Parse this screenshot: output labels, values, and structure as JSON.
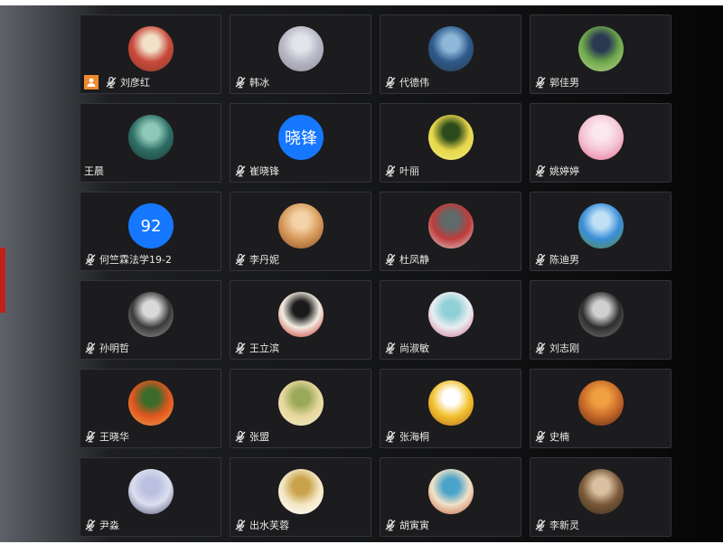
{
  "colors": {
    "tile_bg": "#1c1c1e",
    "text_avatar_bg": "#1677ff",
    "host_badge": "#f08a2c",
    "mic_muted": "#e8e8e8"
  },
  "participants": [
    {
      "name": "刘彦红",
      "muted": true,
      "host": true,
      "avatar": {
        "icon": "portrait-photo",
        "colors": [
          "#c94a3c",
          "#f2e1c9",
          "#8e3b2e"
        ]
      }
    },
    {
      "name": "韩冰",
      "muted": true,
      "avatar": {
        "icon": "portrait-photo",
        "colors": [
          "#b7b7c5",
          "#e3e3ea",
          "#8c8c9c"
        ]
      }
    },
    {
      "name": "代德伟",
      "muted": true,
      "avatar": {
        "icon": "landscape-photo",
        "colors": [
          "#2d5a8a",
          "#8fb8d8",
          "#2a3c4a"
        ]
      }
    },
    {
      "name": "郭佳男",
      "muted": true,
      "avatar": {
        "icon": "portrait-photo",
        "colors": [
          "#6ea84b",
          "#2a3852",
          "#b8d58f"
        ]
      }
    },
    {
      "name": "王晨",
      "muted": false,
      "avatar": {
        "icon": "illustration",
        "colors": [
          "#2f6e66",
          "#8ec9b8",
          "#1d3a35"
        ]
      }
    },
    {
      "name": "崔晓锋",
      "muted": true,
      "avatar": {
        "text": "晓锋",
        "colors": [
          "#1677ff"
        ]
      }
    },
    {
      "name": "叶丽",
      "muted": true,
      "avatar": {
        "icon": "flower-photo",
        "colors": [
          "#e6d64a",
          "#2d4a1a",
          "#f0f080"
        ]
      }
    },
    {
      "name": "姚婷婷",
      "muted": true,
      "avatar": {
        "icon": "anime-illustration",
        "colors": [
          "#f4c5d3",
          "#fbe7ee",
          "#e36a95"
        ]
      }
    },
    {
      "name": "何竺霖法学19-2",
      "muted": true,
      "avatar": {
        "text": "92",
        "colors": [
          "#1677ff"
        ]
      }
    },
    {
      "name": "李丹妮",
      "muted": true,
      "avatar": {
        "icon": "portrait-photo",
        "colors": [
          "#d79a5a",
          "#f3d2a8",
          "#8a4e28"
        ]
      }
    },
    {
      "name": "杜凤静",
      "muted": true,
      "avatar": {
        "icon": "illustration",
        "colors": [
          "#c03b3b",
          "#5f6a6a",
          "#d9d9d9"
        ]
      }
    },
    {
      "name": "陈迪男",
      "muted": true,
      "avatar": {
        "icon": "landscape-photo",
        "colors": [
          "#3b8fd8",
          "#bfe0f5",
          "#5a8a3c"
        ]
      }
    },
    {
      "name": "孙明哲",
      "muted": true,
      "avatar": {
        "icon": "portrait-photo",
        "colors": [
          "#3a3a3a",
          "#d9d9d9",
          "#9a9a9a"
        ]
      }
    },
    {
      "name": "王立滨",
      "muted": true,
      "avatar": {
        "icon": "calligraphy-image",
        "colors": [
          "#f3ede2",
          "#1a1a1a",
          "#c0221b"
        ]
      }
    },
    {
      "name": "尚淑敏",
      "muted": true,
      "avatar": {
        "icon": "illustration",
        "colors": [
          "#e9eef2",
          "#8ed0d6",
          "#d36a8a"
        ]
      }
    },
    {
      "name": "刘志刚",
      "muted": true,
      "avatar": {
        "icon": "portrait-photo",
        "colors": [
          "#2e2e2e",
          "#d0d0d0",
          "#7a7a7a"
        ]
      }
    },
    {
      "name": "王晓华",
      "muted": true,
      "avatar": {
        "icon": "flower-photo",
        "colors": [
          "#e0561f",
          "#3c6b2a",
          "#f2a04a"
        ]
      }
    },
    {
      "name": "张盟",
      "muted": true,
      "avatar": {
        "icon": "illustration",
        "colors": [
          "#e6d79c",
          "#9aa85a",
          "#f4ecc9"
        ]
      }
    },
    {
      "name": "张海桐",
      "muted": true,
      "avatar": {
        "icon": "giraffe-illustration",
        "colors": [
          "#f2c230",
          "#ffffff",
          "#b86a1c"
        ]
      }
    },
    {
      "name": "史楠",
      "muted": true,
      "avatar": {
        "icon": "gallery-photo",
        "colors": [
          "#c96a2a",
          "#f0a040",
          "#5a2a14"
        ]
      }
    },
    {
      "name": "尹淼",
      "muted": true,
      "avatar": {
        "icon": "minimal-image",
        "colors": [
          "#dcdff0",
          "#b9c0e0",
          "#4a4a6a"
        ]
      }
    },
    {
      "name": "出水芙蓉",
      "muted": true,
      "avatar": {
        "icon": "still-life-photo",
        "colors": [
          "#f3e6c3",
          "#c9a24a",
          "#ffffff"
        ]
      }
    },
    {
      "name": "胡寅寅",
      "muted": true,
      "avatar": {
        "icon": "landscape-photo",
        "colors": [
          "#f2e2c8",
          "#4aa3c9",
          "#c45a3a"
        ]
      }
    },
    {
      "name": "李新灵",
      "muted": true,
      "avatar": {
        "icon": "portrait-photo",
        "colors": [
          "#7a5a3a",
          "#d9c0a0",
          "#3a2a1a"
        ]
      }
    }
  ]
}
